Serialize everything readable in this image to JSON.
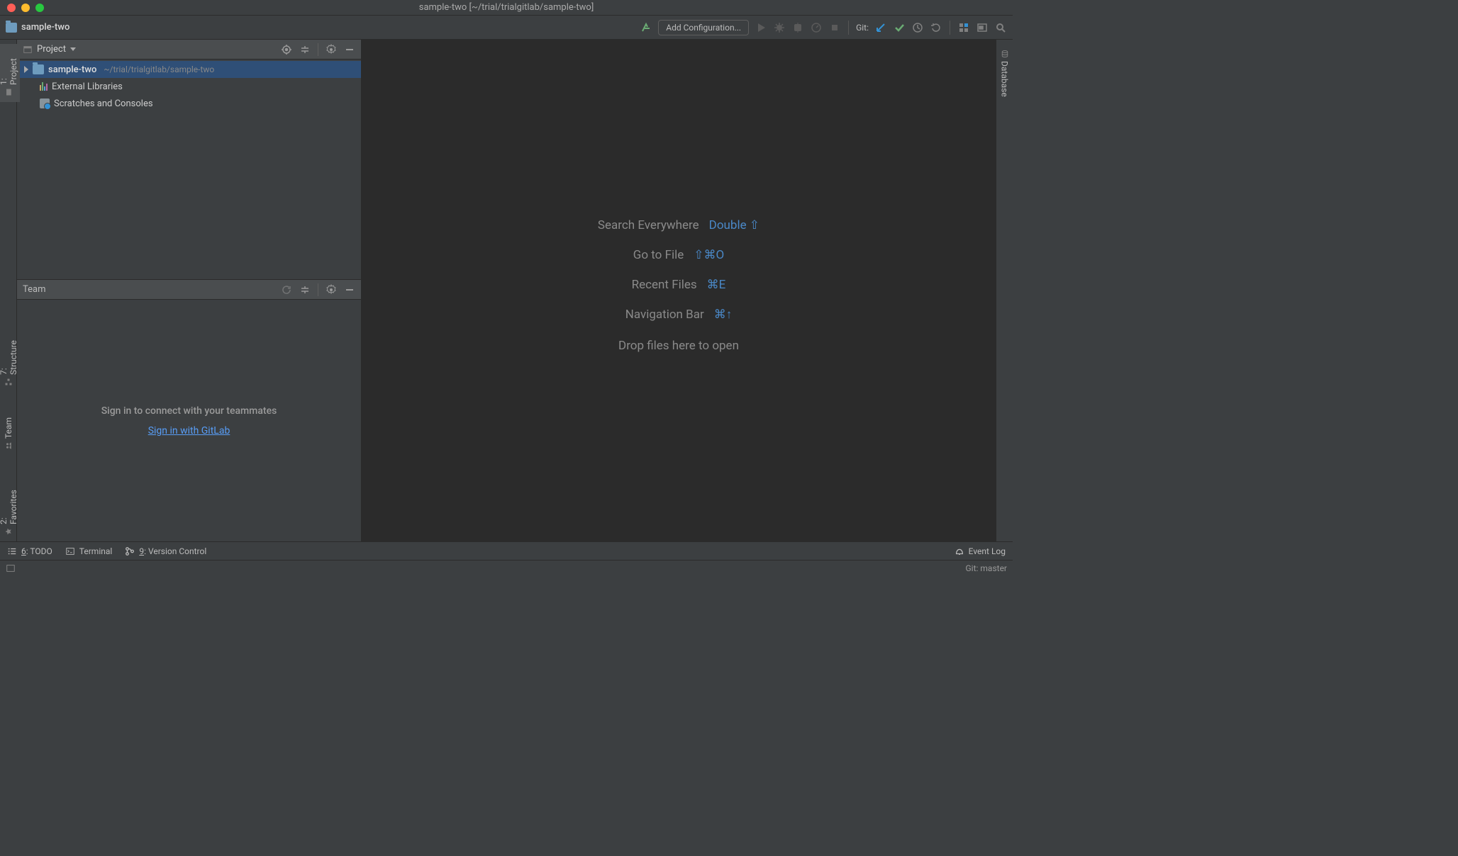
{
  "title": "sample-two [~/trial/trialgitlab/sample-two]",
  "toolbar": {
    "project_name": "sample-two",
    "add_config": "Add Configuration...",
    "git_label": "Git:"
  },
  "left_gutter": {
    "project": "1: Project",
    "structure": "7: Structure",
    "team": "Team",
    "favorites": "2: Favorites"
  },
  "right_gutter": {
    "database": "Database"
  },
  "project_panel": {
    "title": "Project",
    "root_name": "sample-two",
    "root_path": "~/trial/trialgitlab/sample-two",
    "external_libs": "External Libraries",
    "scratches": "Scratches and Consoles"
  },
  "team_panel": {
    "title": "Team",
    "message": "Sign in to connect with your teammates",
    "link": "Sign in with GitLab"
  },
  "editor_hints": {
    "search_label": "Search Everywhere",
    "search_key": "Double ⇧",
    "goto_label": "Go to File",
    "goto_key": "⇧⌘O",
    "recent_label": "Recent Files",
    "recent_key": "⌘E",
    "nav_label": "Navigation Bar",
    "nav_key": "⌘↑",
    "drop": "Drop files here to open"
  },
  "bottom": {
    "todo": "6: TODO",
    "terminal": "Terminal",
    "vcs": "9: Version Control",
    "eventlog": "Event Log"
  },
  "status": {
    "git": "Git: master"
  }
}
